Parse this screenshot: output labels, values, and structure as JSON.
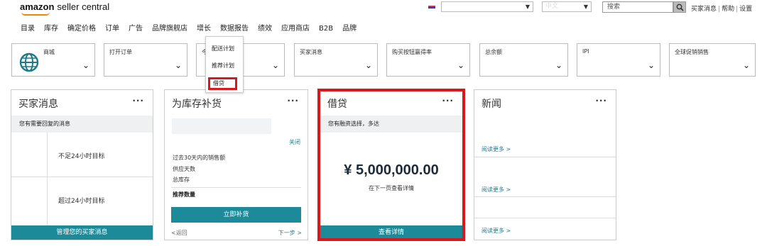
{
  "header": {
    "logo_brand": "amazon",
    "logo_sub": "seller central",
    "search_placeholder": "搜索",
    "top_links": [
      "买家消息",
      "帮助",
      "设置"
    ],
    "select2_value": "中文"
  },
  "nav": [
    "目录",
    "库存",
    "确定价格",
    "订单",
    "广告",
    "品牌旗舰店",
    "增长",
    "数据报告",
    "绩效",
    "应用商店",
    "B2B",
    "品牌"
  ],
  "dropdown": [
    "配送计划",
    "推荐计划",
    "借贷"
  ],
  "filters": [
    {
      "label": "商城",
      "icon": "globe-icon"
    },
    {
      "label": "打开订单"
    },
    {
      "label": "今"
    },
    {
      "label": "买家消息"
    },
    {
      "label": "购买按钮赢得率"
    },
    {
      "label": "总余额"
    },
    {
      "label": "IPI"
    },
    {
      "label": "全球促销销售"
    }
  ],
  "cards": {
    "buyer_messages": {
      "title": "买家消息",
      "band": "您有需要回复的消息",
      "row1": "不足24小时目标",
      "row2": "超过24小时目标",
      "button": "管理您的买家消息"
    },
    "restock": {
      "title": "为库存补货",
      "close": "关闭",
      "lines": [
        "过去30天内的销售额",
        "供应天数",
        "总库存"
      ],
      "bold": "推荐数量",
      "button": "立即补货",
      "prev": "<返回",
      "next": "下一步 >"
    },
    "lending": {
      "title": "借贷",
      "band": "您有融资选择，多达",
      "amount": "¥ 5,000,000.00",
      "sub": "在下一页查看详情",
      "button": "查看详情"
    },
    "news": {
      "title": "新闻",
      "read_more": [
        "阅读更多 >",
        "阅读更多 >",
        "阅读更多 >"
      ]
    }
  },
  "colors": {
    "teal": "#1d8a99",
    "highlight_red": "#d7191c",
    "band_gray": "#eef0f2"
  }
}
